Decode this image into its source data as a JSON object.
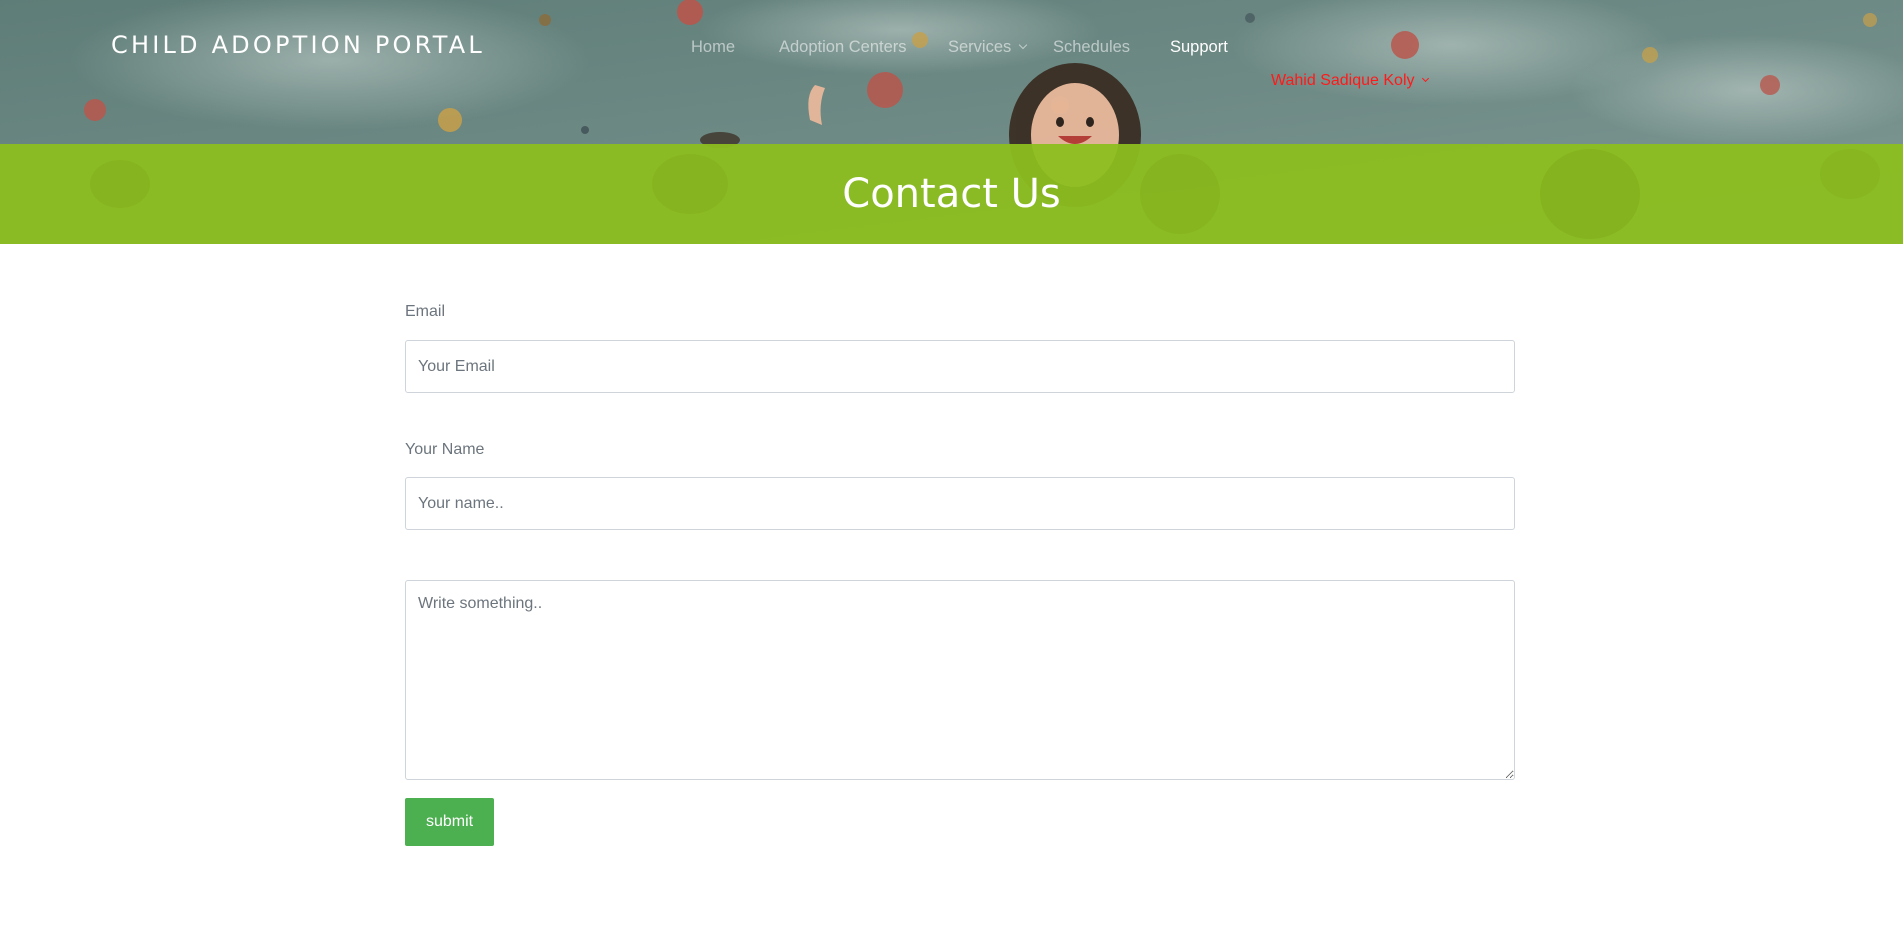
{
  "header": {
    "brand": "CHILD ADOPTION PORTAL",
    "nav": {
      "home": "Home",
      "adoption_centers": "Adoption Centers",
      "services": "Services",
      "schedules": "Schedules",
      "support": "Support"
    },
    "user": "Wahid Sadique Koly"
  },
  "page": {
    "title": "Contact Us"
  },
  "form": {
    "email_label": "Email",
    "email_placeholder": "Your Email",
    "name_label": "Your Name",
    "name_placeholder": "Your name..",
    "message_placeholder": "Write something..",
    "submit_label": "submit"
  },
  "colors": {
    "title_band": "#8cbe1e",
    "submit_button": "#4caf50",
    "user_menu": "#ff1a1a",
    "active_nav": "#ffffff"
  }
}
